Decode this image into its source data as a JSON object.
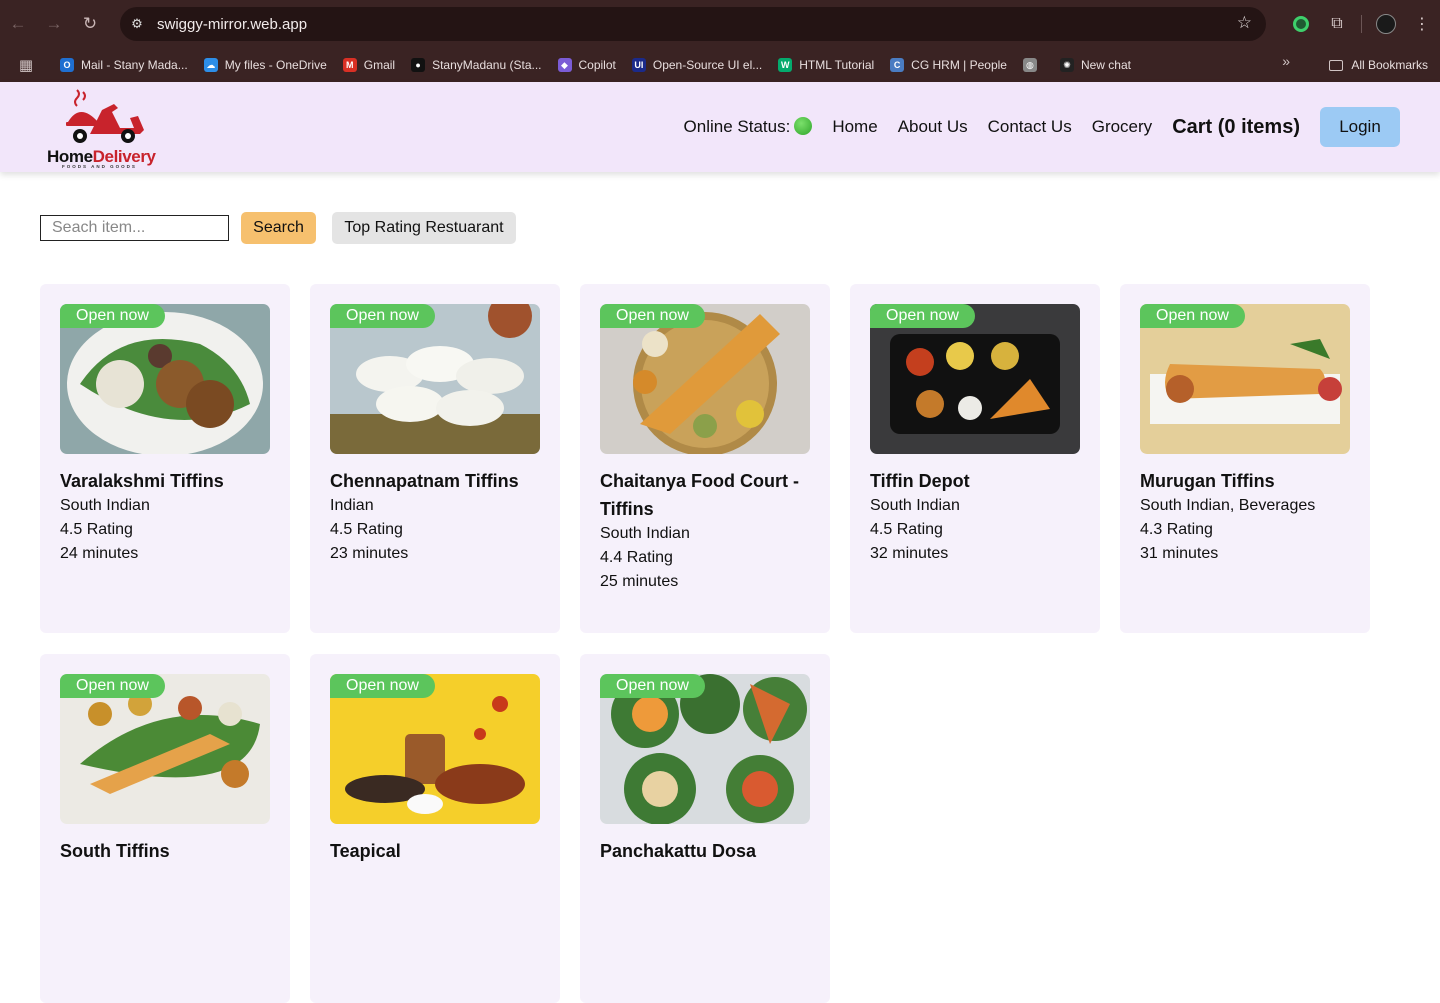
{
  "browser": {
    "url": "swiggy-mirror.web.app",
    "bookmarks": [
      {
        "label": "Mail - Stany Mada...",
        "color": "#1f6fd1",
        "glyph": "O"
      },
      {
        "label": "My files - OneDrive",
        "color": "#2d8ee8",
        "glyph": "☁"
      },
      {
        "label": "Gmail",
        "color": "#d93025",
        "glyph": "M"
      },
      {
        "label": "StanyMadanu (Sta...",
        "color": "#111111",
        "glyph": "●"
      },
      {
        "label": "Copilot",
        "color": "#7b5cd6",
        "glyph": "◆"
      },
      {
        "label": "Open-Source UI el...",
        "color": "#1b2a8a",
        "glyph": "UI"
      },
      {
        "label": "HTML Tutorial",
        "color": "#04aa6d",
        "glyph": "W"
      },
      {
        "label": "CG HRM | People",
        "color": "#4a7cc2",
        "glyph": "C"
      },
      {
        "label": "",
        "color": "#888888",
        "glyph": "◍"
      },
      {
        "label": "New chat",
        "color": "#222222",
        "glyph": "✺"
      }
    ],
    "all_bookmarks": "All Bookmarks"
  },
  "header": {
    "logo_home": "Home",
    "logo_delivery": "Delivery",
    "logo_tagline": "FOODS AND GOODS",
    "online_status_label": "Online Status:",
    "nav": [
      "Home",
      "About Us",
      "Contact Us",
      "Grocery"
    ],
    "cart": "Cart (0 items)",
    "login": "Login"
  },
  "search": {
    "placeholder": "Seach item...",
    "button": "Search",
    "top_rating_button": "Top Rating Restuarant"
  },
  "restaurants": [
    {
      "badge": "Open now",
      "name": "Varalakshmi Tiffins",
      "cuisine": "South Indian",
      "rating": "4.5 Rating",
      "time": "24 minutes"
    },
    {
      "badge": "Open now",
      "name": "Chennapatnam Tiffins",
      "cuisine": "Indian",
      "rating": "4.5 Rating",
      "time": "23 minutes"
    },
    {
      "badge": "Open now",
      "name": "Chaitanya Food Court - Tiffins",
      "cuisine": "South Indian",
      "rating": "4.4 Rating",
      "time": "25 minutes"
    },
    {
      "badge": "Open now",
      "name": "Tiffin Depot",
      "cuisine": "South Indian",
      "rating": "4.5 Rating",
      "time": "32 minutes"
    },
    {
      "badge": "Open now",
      "name": "Murugan Tiffins",
      "cuisine": "South Indian, Beverages",
      "rating": "4.3 Rating",
      "time": "31 minutes"
    },
    {
      "badge": "Open now",
      "name": "South Tiffins",
      "cuisine": "",
      "rating": "",
      "time": ""
    },
    {
      "badge": "Open now",
      "name": "Teapical",
      "cuisine": "",
      "rating": "",
      "time": ""
    },
    {
      "badge": "Open now",
      "name": "Panchakattu Dosa",
      "cuisine": "",
      "rating": "",
      "time": ""
    }
  ]
}
